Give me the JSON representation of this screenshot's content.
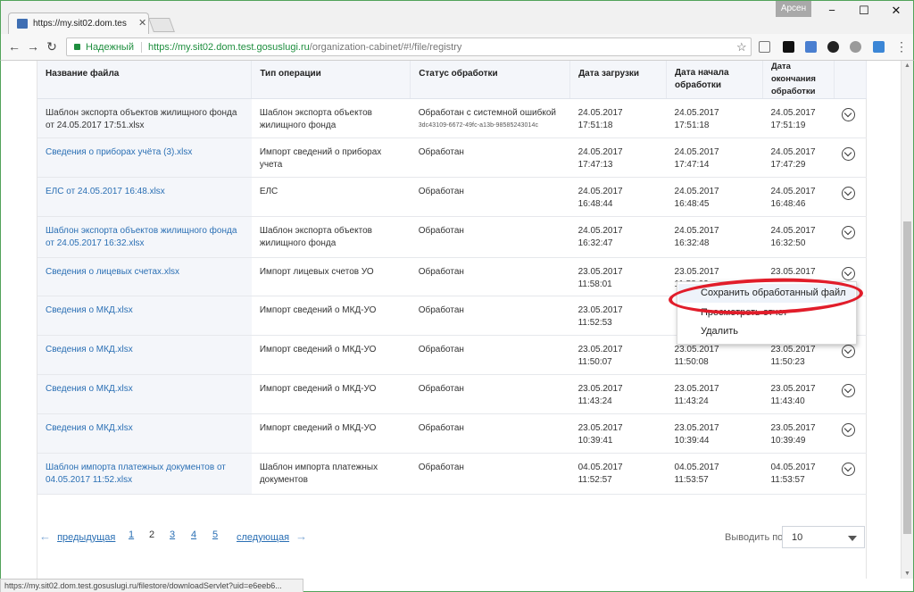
{
  "browser": {
    "tab_title": "https://my.sit02.dom.tes",
    "user_badge": "Арсен",
    "secure_label": "Надежный",
    "url_base": "https://my.sit02.dom.test.gosuslugi.ru",
    "url_path": "/organization-cabinet/#!/file/registry",
    "status_url": "https://my.sit02.dom.test.gosuslugi.ru/filestore/downloadServlet?uid=e6eeb6..."
  },
  "table": {
    "headers": {
      "name": "Название файла",
      "operation": "Тип операции",
      "status": "Статус обработки",
      "uploaded": "Дата загрузки",
      "started": "Дата начала обработки",
      "finished": "Дата окончания обработки"
    },
    "rows": [
      {
        "name": "Шаблон экспорта объектов жилищного фонда от 24.05.2017 17:51.xlsx",
        "link": false,
        "operation": "Шаблон экспорта объектов жилищного фонда",
        "status": "Обработан с системной ошибкой",
        "status_id": "3dc43109-6672-49fc-a13b-98585243014c",
        "uploaded": "24.05.2017 17:51:18",
        "started": "24.05.2017 17:51:18",
        "finished": "24.05.2017 17:51:19"
      },
      {
        "name": "Сведения о приборах учёта (3).xlsx",
        "link": true,
        "operation": "Импорт сведений о приборах учета",
        "status": "Обработан",
        "status_id": "",
        "uploaded": "24.05.2017 17:47:13",
        "started": "24.05.2017 17:47:14",
        "finished": "24.05.2017 17:47:29"
      },
      {
        "name": "ЕЛС от 24.05.2017 16:48.xlsx",
        "link": true,
        "operation": "ЕЛС",
        "status": "Обработан",
        "status_id": "",
        "uploaded": "24.05.2017 16:48:44",
        "started": "24.05.2017 16:48:45",
        "finished": "24.05.2017 16:48:46"
      },
      {
        "name": "Шаблон экспорта объектов жилищного фонда от 24.05.2017 16:32.xlsx",
        "link": true,
        "operation": "Шаблон экспорта объектов жилищного фонда",
        "status": "Обработан",
        "status_id": "",
        "uploaded": "24.05.2017 16:32:47",
        "started": "24.05.2017 16:32:48",
        "finished": "24.05.2017 16:32:50"
      },
      {
        "name": "Сведения о лицевых счетах.xlsx",
        "link": true,
        "operation": "Импорт лицевых счетов УО",
        "status": "Обработан",
        "status_id": "",
        "uploaded": "23.05.2017 11:58:01",
        "started": "23.05.2017 11:58:02",
        "finished": "23.05.2017"
      },
      {
        "name": "Сведения о МКД.xlsx",
        "link": true,
        "operation": "Импорт сведений о МКД-УО",
        "status": "Обработан",
        "status_id": "",
        "uploaded": "23.05.2017 11:52:53",
        "started": "",
        "finished": ""
      },
      {
        "name": "Сведения о МКД.xlsx",
        "link": true,
        "operation": "Импорт сведений о МКД-УО",
        "status": "Обработан",
        "status_id": "",
        "uploaded": "23.05.2017 11:50:07",
        "started": "23.05.2017 11:50:08",
        "finished": "23.05.2017 11:50:23"
      },
      {
        "name": "Сведения о МКД.xlsx",
        "link": true,
        "operation": "Импорт сведений о МКД-УО",
        "status": "Обработан",
        "status_id": "",
        "uploaded": "23.05.2017 11:43:24",
        "started": "23.05.2017 11:43:24",
        "finished": "23.05.2017 11:43:40"
      },
      {
        "name": "Сведения о МКД.xlsx",
        "link": true,
        "operation": "Импорт сведений о МКД-УО",
        "status": "Обработан",
        "status_id": "",
        "uploaded": "23.05.2017 10:39:41",
        "started": "23.05.2017 10:39:44",
        "finished": "23.05.2017 10:39:49"
      },
      {
        "name": "Шаблон импорта платежных документов от 04.05.2017 11:52.xlsx",
        "link": true,
        "operation": "Шаблон импорта платежных документов",
        "status": "Обработан",
        "status_id": "",
        "uploaded": "04.05.2017 11:52:57",
        "started": "04.05.2017 11:53:57",
        "finished": "04.05.2017 11:53:57"
      }
    ]
  },
  "context_menu": {
    "items": [
      "Сохранить обработанный файл",
      "Просмотреть отчет",
      "Удалить"
    ]
  },
  "pagination": {
    "prev": "предыдущая",
    "pages": [
      "1",
      "2",
      "3",
      "4",
      "5"
    ],
    "current": "2",
    "next": "следующая",
    "per_page_label": "Выводить по",
    "per_page_value": "10"
  },
  "colors": {
    "link": "#2a6fb4",
    "highlight_oval": "#e11d2a",
    "secure": "#1e8e3e"
  }
}
